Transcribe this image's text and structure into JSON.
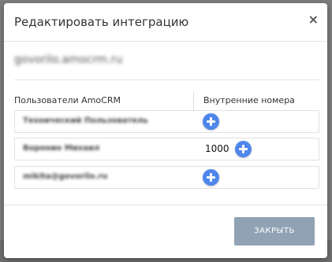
{
  "modal": {
    "title": "Редактировать интеграцию",
    "close_icon": "close-icon",
    "domain": "govorilo.amocrm.ru",
    "columns": {
      "users": "Пользователи AmoCRM",
      "numbers": "Внутренние номера"
    },
    "rows": [
      {
        "user": "Технический Пользователь",
        "number": ""
      },
      {
        "user": "Воронин Михаил",
        "number": "1000"
      },
      {
        "user": "mikita@govorilo.ru",
        "number": ""
      }
    ],
    "add_icon": "plus-circle-icon",
    "close_button_label": "ЗАКРЫТЬ"
  },
  "colors": {
    "accent": "#4f86ec",
    "button": "#90a2b3",
    "backdrop": "#7d7d7d"
  }
}
